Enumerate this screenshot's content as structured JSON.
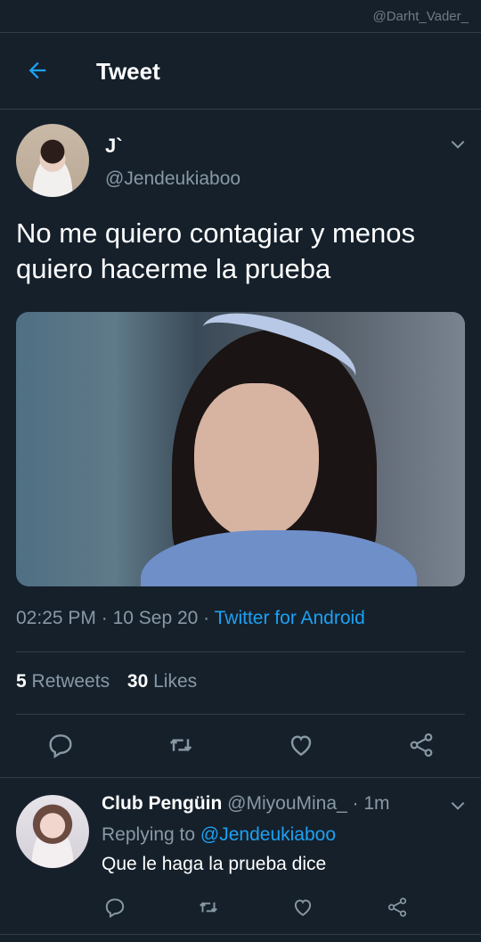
{
  "watermark": "@Darht_Vader_",
  "header": {
    "title": "Tweet",
    "back_icon": "arrow-left-icon"
  },
  "tweet": {
    "author_name": "J`",
    "author_handle": "@Jendeukiaboo",
    "text": "No me quiero contagiar y menos quiero hacerme la prueba",
    "time": "02:25 PM",
    "date": "10 Sep 20",
    "source": "Twitter for Android",
    "separator": " · ",
    "retweets_count": "5",
    "retweets_label": "Retweets",
    "likes_count": "30",
    "likes_label": "Likes"
  },
  "reply": {
    "author_name": "Club Pengüin",
    "author_handle": "@MiyouMina_",
    "time": "· 1m",
    "replying_label": "Replying to",
    "replying_to": "@Jendeukiaboo",
    "text": "Que le haga la prueba dice"
  },
  "colors": {
    "background": "#15202b",
    "accent": "#1da1f2",
    "muted": "#8899a6",
    "divider": "#2f3d4a"
  }
}
